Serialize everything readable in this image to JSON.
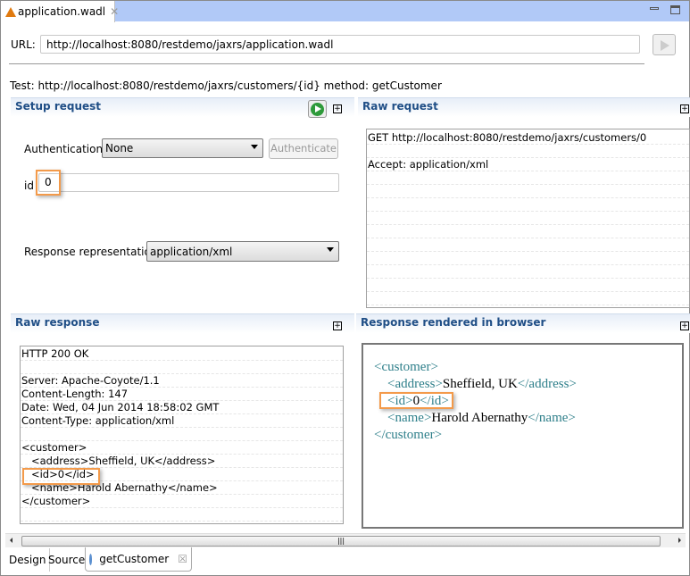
{
  "editor_tab": {
    "title": "application.wadl",
    "icon": "wadl-file-icon"
  },
  "url": {
    "label": "URL:",
    "value": "http://localhost:8080/restdemo/jaxrs/application.wadl"
  },
  "test_line": "Test: http://localhost:8080/restdemo/jaxrs/customers/{id} method: getCustomer",
  "setup": {
    "title": "Setup request",
    "auth_label": "Authentication:",
    "auth_value": "None",
    "authenticate_button": "Authenticate",
    "id_label": "id",
    "id_value": "0",
    "repr_label": "Response representation:",
    "repr_value": "application/xml"
  },
  "raw_request": {
    "title": "Raw request",
    "lines": [
      "GET http://localhost:8080/restdemo/jaxrs/customers/0",
      "",
      "Accept: application/xml",
      "",
      "",
      "",
      "",
      "",
      "",
      "",
      "",
      "",
      ""
    ]
  },
  "raw_response": {
    "title": "Raw response",
    "lines": [
      "HTTP 200 OK",
      "",
      "Server: Apache-Coyote/1.1",
      "Content-Length: 147",
      "Date: Wed, 04 Jun 2014 18:58:02 GMT",
      "Content-Type: application/xml",
      "",
      "<customer>",
      "   <address>Sheffield, UK</address>",
      "   <id>0</id>",
      "   <name>Harold Abernathy</name>",
      "</customer>",
      ""
    ]
  },
  "rendered": {
    "title": "Response rendered in browser",
    "root_open": "<customer>",
    "root_close": "</customer>",
    "fields": [
      {
        "open": "<address>",
        "value": "Sheffield, UK",
        "close": "</address>"
      },
      {
        "open": "<id>",
        "value": "0",
        "close": "</id>"
      },
      {
        "open": "<name>",
        "value": "Harold Abernathy",
        "close": "</name>"
      }
    ]
  },
  "bottom_tabs": [
    {
      "label": "Design"
    },
    {
      "label": "Source"
    },
    {
      "label": "getCustomer",
      "icon": "method-icon"
    }
  ],
  "colors": {
    "highlight": "#f39a4a",
    "tabbar": "#b1c9f7",
    "header_text": "#1f4e86",
    "xml_tag": "#2e7f8a"
  }
}
